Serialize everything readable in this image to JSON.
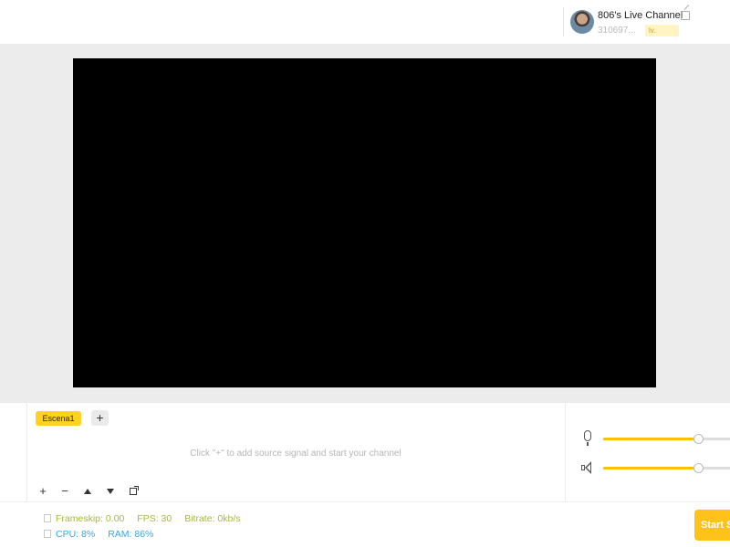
{
  "header": {
    "channel_name": "806's Live Channel",
    "channel_id": "310697...",
    "level_badge": "lv."
  },
  "scenes": {
    "active_tab": "Escena1",
    "add_label": "+",
    "empty_hint": "Click \"+\" to add source signal and start your channel"
  },
  "tools": [
    "+",
    "−"
  ],
  "audio": {
    "mic_level": 0.74,
    "speaker_level": 0.74
  },
  "stats": {
    "frameskip": "Frameskip: 0.00",
    "fps": "FPS: 30",
    "bitrate": "Bitrate: 0kb/s",
    "cpu": "CPU: 8%",
    "ram": "RAM: 86%"
  },
  "start_button": "Start Streaming",
  "colors": {
    "accent": "#ffd21e",
    "stat_green": "#a6b83a",
    "stat_blue": "#3aa6e0"
  }
}
